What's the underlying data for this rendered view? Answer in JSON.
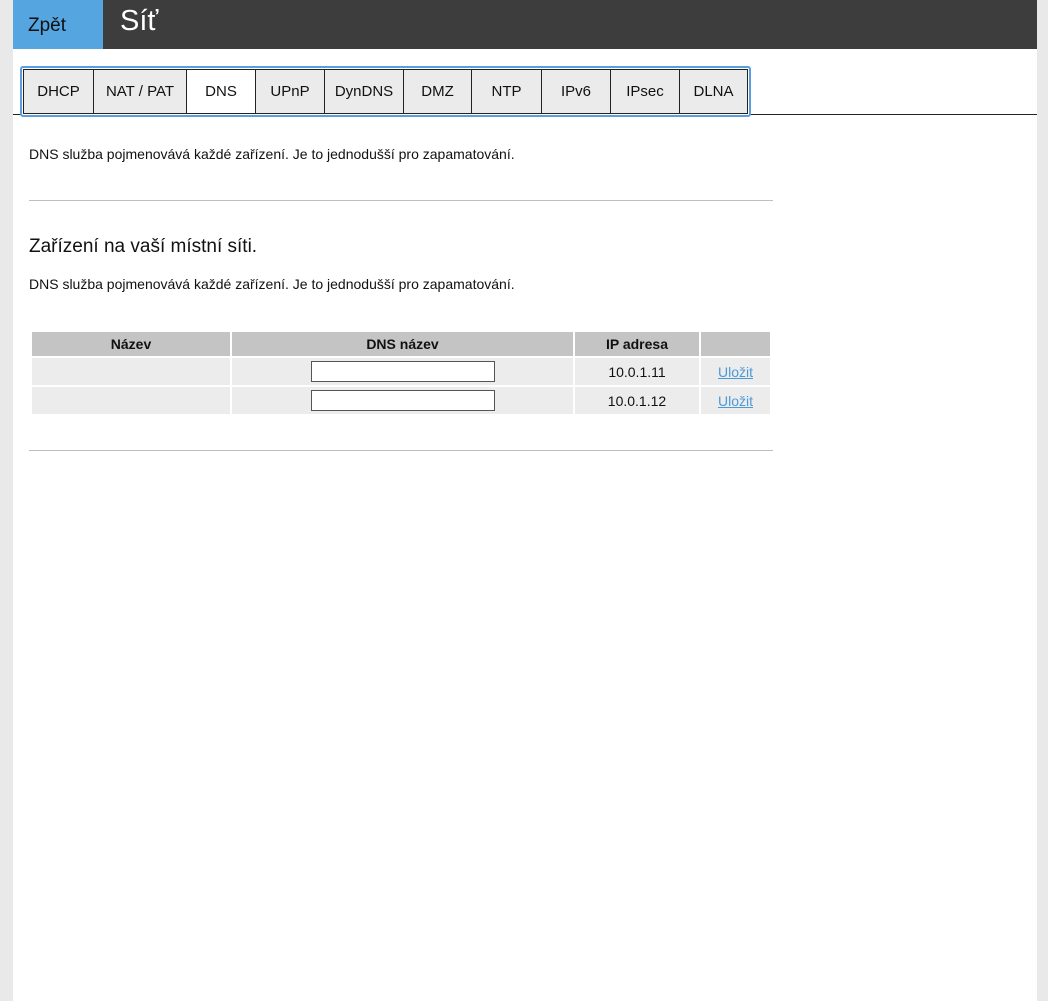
{
  "header": {
    "back_label": "Zpět",
    "title": "Síť"
  },
  "tabs": [
    {
      "label": "DHCP",
      "active": false
    },
    {
      "label": "NAT / PAT",
      "active": false
    },
    {
      "label": "DNS",
      "active": true
    },
    {
      "label": "UPnP",
      "active": false
    },
    {
      "label": "DynDNS",
      "active": false
    },
    {
      "label": "DMZ",
      "active": false
    },
    {
      "label": "NTP",
      "active": false
    },
    {
      "label": "IPv6",
      "active": false
    },
    {
      "label": "IPsec",
      "active": false
    },
    {
      "label": "DLNA",
      "active": false
    }
  ],
  "intro_text": "DNS služba pojmenovává každé zařízení. Je to jednodušší pro zapamatování.",
  "section": {
    "title": "Zařízení na vaší místní síti.",
    "description": "DNS služba pojmenovává každé zařízení. Je to jednodušší pro zapamatování."
  },
  "table": {
    "headers": [
      "Název",
      "DNS název",
      "IP adresa",
      ""
    ],
    "rows": [
      {
        "name": "",
        "dns_value": "",
        "ip": "10.0.1.11",
        "action": "Uložit"
      },
      {
        "name": "",
        "dns_value": "",
        "ip": "10.0.1.12",
        "action": "Uložit"
      }
    ]
  },
  "colors": {
    "header_bg": "#3d3d3d",
    "back_button_bg": "#55a5e0",
    "tabs_border": "#5a9ee0",
    "link": "#4a9ad8"
  }
}
